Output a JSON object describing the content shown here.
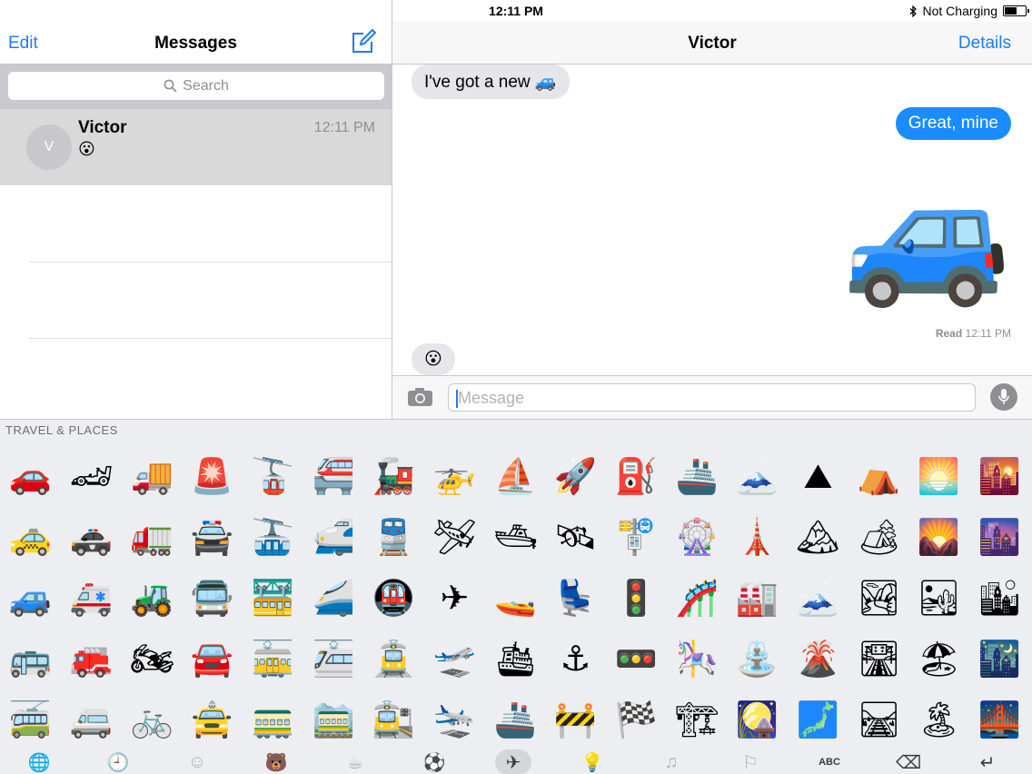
{
  "status": {
    "device": "iPad",
    "time": "12:11 PM",
    "charging": "Not Charging"
  },
  "sidebar": {
    "edit_label": "Edit",
    "title": "Messages",
    "search_placeholder": "Search",
    "conversation": {
      "avatar_initial": "V",
      "name": "Victor",
      "time": "12:11 PM",
      "preview": "😮"
    }
  },
  "chat": {
    "title": "Victor",
    "details_label": "Details",
    "messages": [
      {
        "from": "in",
        "text": "I've got a new 🚙"
      },
      {
        "from": "out",
        "text": "Great, mine"
      },
      {
        "from": "out",
        "text": "🚙"
      },
      {
        "from": "in",
        "text": "😮"
      }
    ],
    "receipt_label": "Read",
    "receipt_time": "12:11 PM",
    "input_placeholder": "Message"
  },
  "keyboard": {
    "category_label": "TRAVEL & PLACES",
    "emoji_rows": [
      [
        "🚗",
        "🏎",
        "🚚",
        "🚨",
        "🚡",
        "🚝",
        "🚂",
        "🚁",
        "⛵",
        "🚀",
        "⛽",
        "🚢",
        "🗻",
        "⛰",
        "⛺",
        "🌅",
        "🌇"
      ],
      [
        "🚕",
        "🚓",
        "🚛",
        "🚔",
        "🚠",
        "🚅",
        "🚆",
        "🛩",
        "🛥",
        "🛰",
        "🚏",
        "🎡",
        "🗼",
        "🏔",
        "🏕",
        "🌄",
        "🌆"
      ],
      [
        "🚙",
        "🚑",
        "🚜",
        "🚍",
        "🚟",
        "🚄",
        "🚇",
        "✈",
        "🚤",
        "💺",
        "🚦",
        "🎢",
        "🏭",
        "🗻",
        "🏞",
        "🏜",
        "🏙"
      ],
      [
        "🚌",
        "🚒",
        "🏍",
        "🚘",
        "🚋",
        "🚈",
        "🚊",
        "🛫",
        "🛳",
        "⚓",
        "🚥",
        "🎠",
        "⛲",
        "🌋",
        "🛣",
        "🏖",
        "🌃"
      ],
      [
        "🚎",
        "🚐",
        "🚲",
        "🚖",
        "🚃",
        "🚞",
        "🚉",
        "🛬",
        "🚢",
        "🚧",
        "🏁",
        "🏗",
        "🎑",
        "🗾",
        "🛤",
        "🏝",
        "🌉"
      ]
    ],
    "tabs": [
      {
        "name": "globe-icon",
        "glyph": "🌐",
        "state": "dark"
      },
      {
        "name": "recent-icon",
        "glyph": "🕘",
        "state": "dim"
      },
      {
        "name": "smiley-icon",
        "glyph": "☺",
        "state": "dim"
      },
      {
        "name": "animal-icon",
        "glyph": "🐻",
        "state": "dim"
      },
      {
        "name": "food-icon",
        "glyph": "☕",
        "state": "dim"
      },
      {
        "name": "activity-icon",
        "glyph": "⚽",
        "state": "dim"
      },
      {
        "name": "travel-icon",
        "glyph": "✈",
        "state": "selected"
      },
      {
        "name": "objects-icon",
        "glyph": "💡",
        "state": "dim"
      },
      {
        "name": "symbols-icon",
        "glyph": "♫",
        "state": "dim"
      },
      {
        "name": "flags-icon",
        "glyph": "⚐",
        "state": "dim"
      },
      {
        "name": "abc-key",
        "glyph": "ABC",
        "state": "abc"
      },
      {
        "name": "delete-icon",
        "glyph": "⌫",
        "state": "dark"
      },
      {
        "name": "return-icon",
        "glyph": "↵",
        "state": "dark"
      }
    ]
  },
  "colors": {
    "accent": "#1a7cf5",
    "outgoing_bubble": "#1a8cff",
    "incoming_bubble": "#e5e5ea",
    "selected_row": "#d9d9d9"
  }
}
